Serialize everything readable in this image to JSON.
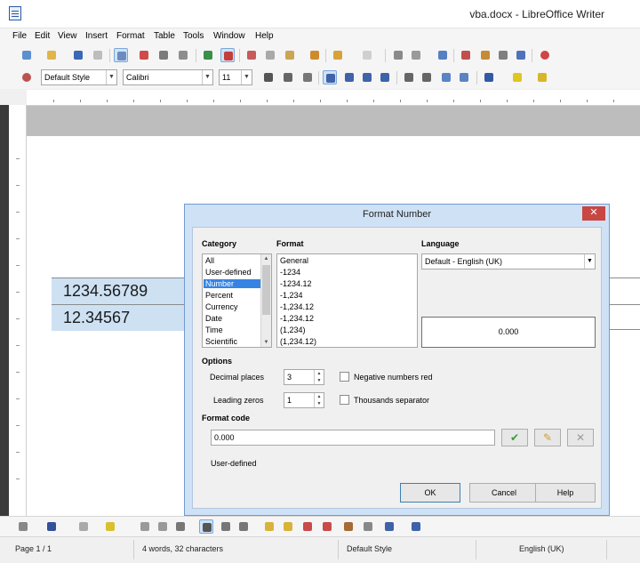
{
  "window": {
    "title": "vba.docx - LibreOffice Writer"
  },
  "menu": [
    "File",
    "Edit",
    "View",
    "Insert",
    "Format",
    "Table",
    "Tools",
    "Window",
    "Help"
  ],
  "formatting": {
    "style": "Default Style",
    "font": "Calibri",
    "size": "11"
  },
  "document": {
    "cells": [
      "1234.56789",
      "12.34567"
    ]
  },
  "dialog": {
    "title": "Format Number",
    "close_symbol": "✕",
    "category_label": "Category",
    "categories": [
      "All",
      "User-defined",
      "Number",
      "Percent",
      "Currency",
      "Date",
      "Time",
      "Scientific"
    ],
    "selected_category": "Number",
    "format_label": "Format",
    "formats": [
      "General",
      "-1234",
      "-1234.12",
      "-1,234",
      "-1,234.12",
      "-1,234.12",
      "(1,234)",
      "(1,234.12)"
    ],
    "language_label": "Language",
    "language_value": "Default - English (UK)",
    "preview_value": "0.000",
    "options_label": "Options",
    "decimal_places_label": "Decimal places",
    "decimal_places_value": "3",
    "leading_zeros_label": "Leading zeros",
    "leading_zeros_value": "1",
    "negative_red_label": "Negative numbers red",
    "negative_red_checked": false,
    "thousands_sep_label": "Thousands separator",
    "thousands_sep_checked": false,
    "format_code_label": "Format code",
    "format_code_value": "0.000",
    "format_code_status": "User-defined",
    "ok_label": "OK",
    "cancel_label": "Cancel",
    "help_label": "Help"
  },
  "status": {
    "page": "Page 1 / 1",
    "words": "4 words, 32 characters",
    "style": "Default Style",
    "language": "English (UK)"
  },
  "colors": {
    "selection": "#3584e4",
    "cell_highlight": "#cde1f3",
    "dialog_frame": "#cfe1f5",
    "close_button": "#c94742"
  }
}
